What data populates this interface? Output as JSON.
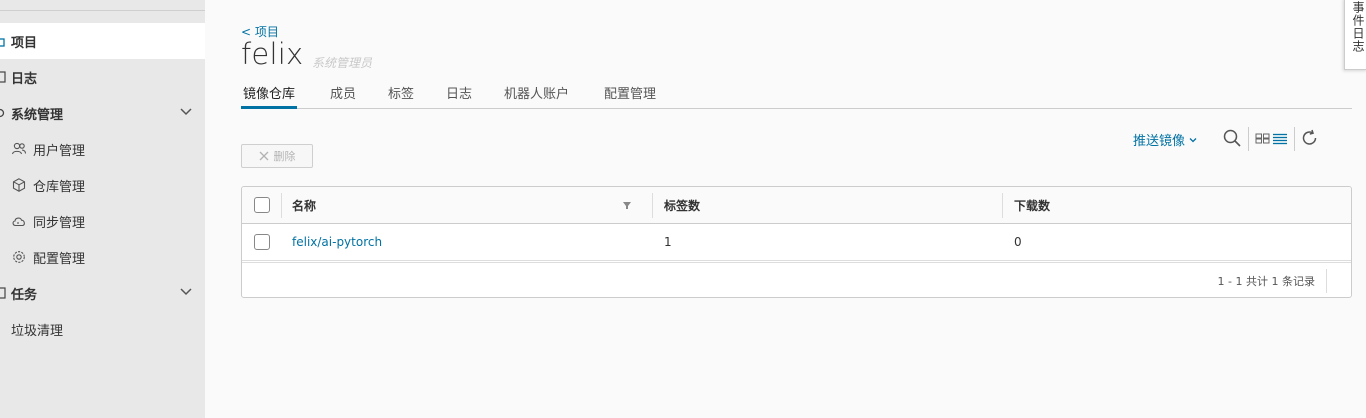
{
  "sidebar": {
    "items": [
      {
        "label": "项目",
        "icon": "project-icon"
      },
      {
        "label": "日志",
        "icon": "log-icon"
      },
      {
        "label": "系统管理",
        "icon": "gear-icon"
      },
      {
        "label": "用户管理",
        "icon": "users-icon"
      },
      {
        "label": "仓库管理",
        "icon": "box-icon"
      },
      {
        "label": "同步管理",
        "icon": "cloud-sync-icon"
      },
      {
        "label": "配置管理",
        "icon": "cog-icon"
      },
      {
        "label": "任务",
        "icon": "task-icon"
      },
      {
        "label": "垃圾清理",
        "icon": ""
      }
    ]
  },
  "breadcrumb": "< 项目",
  "project": {
    "name": "felix",
    "role": "系统管理员"
  },
  "tabs": [
    "镜像仓库",
    "成员",
    "标签",
    "日志",
    "机器人账户",
    "配置管理"
  ],
  "toolbar": {
    "push_label": "推送镜像",
    "delete_label": "删除"
  },
  "table": {
    "columns": [
      "名称",
      "标签数",
      "下载数"
    ],
    "rows": [
      {
        "name": "felix/ai-pytorch",
        "tags": "1",
        "downloads": "0"
      }
    ],
    "pagination": "1 - 1 共计 1 条记录"
  },
  "event_log_tab": "事件日志",
  "colors": {
    "accent": "#0072a3",
    "sidebar_bg": "#e8e8e8",
    "active_bg": "#ffffff"
  }
}
